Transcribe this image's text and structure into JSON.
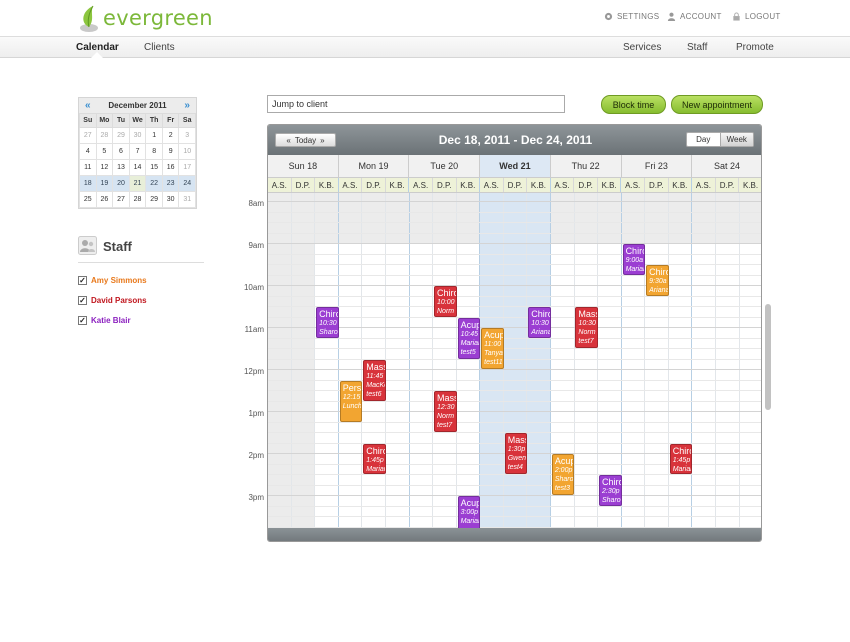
{
  "app": {
    "logo_text": "evergreen",
    "top_links": [
      "SETTINGS",
      "ACCOUNT",
      "LOGOUT"
    ],
    "nav_left": [
      "Calendar",
      "Clients"
    ],
    "nav_right": [
      "Services",
      "Staff",
      "Promote"
    ]
  },
  "minical": {
    "month": "December 2011",
    "prev": "«",
    "next": "»",
    "weekdays": [
      "Su",
      "Mo",
      "Tu",
      "We",
      "Th",
      "Fr",
      "Sa"
    ],
    "weeks": [
      [
        "27",
        "28",
        "29",
        "30",
        "1",
        "2",
        "3"
      ],
      [
        "4",
        "5",
        "6",
        "7",
        "8",
        "9",
        "10"
      ],
      [
        "11",
        "12",
        "13",
        "14",
        "15",
        "16",
        "17"
      ],
      [
        "18",
        "19",
        "20",
        "21",
        "22",
        "23",
        "24"
      ],
      [
        "25",
        "26",
        "27",
        "28",
        "29",
        "30",
        "31"
      ]
    ]
  },
  "staff": {
    "title": "Staff",
    "members": [
      {
        "name": "Amy Simmons",
        "color": "#e8781a"
      },
      {
        "name": "David Parsons",
        "color": "#c0151d"
      },
      {
        "name": "Katie Blair",
        "color": "#8b1fbf"
      }
    ]
  },
  "toolbar": {
    "jump_placeholder": "Jump to client",
    "block_time": "Block time",
    "new_appointment": "New appointment"
  },
  "calendar": {
    "today_label": "Today",
    "range": "Dec 18, 2011 - Dec 24, 2011",
    "view_day": "Day",
    "view_week": "Week",
    "days": [
      "Sun 18",
      "Mon 19",
      "Tue 20",
      "Wed 21",
      "Thu 22",
      "Fri 23",
      "Sat 24"
    ],
    "staff_initials": [
      "A.S.",
      "D.P.",
      "K.B."
    ],
    "times": [
      "8am",
      "9am",
      "10am",
      "11am",
      "12pm",
      "1pm",
      "2pm",
      "3pm"
    ],
    "colors": {
      "purple": "#9b3ed2",
      "red": "#d8333b",
      "orange": "#f2a531"
    },
    "events": [
      {
        "title": "Chiro",
        "time": "9:00a",
        "client": "Marian",
        "color": "purple"
      },
      {
        "title": "Chiro",
        "time": "9:30a",
        "client": "Ariana",
        "color": "orange"
      },
      {
        "title": "Chiro",
        "time": "10:00",
        "client": "Norm",
        "color": "red"
      },
      {
        "title": "Chiro",
        "time": "10:30",
        "client": "Sharo",
        "color": "purple"
      },
      {
        "title": "Acup",
        "time": "10:45",
        "client": "Marian",
        "extra": "test5",
        "color": "purple"
      },
      {
        "title": "Acup",
        "time": "11:00",
        "client": "Tanya",
        "extra": "test11",
        "color": "orange"
      },
      {
        "title": "Chiro",
        "time": "10:30",
        "client": "Ariana",
        "color": "purple"
      },
      {
        "title": "Mass",
        "time": "10:30",
        "client": "Norm",
        "extra": "test7",
        "color": "red"
      },
      {
        "title": "Mass",
        "time": "11:45",
        "client": "MacKe",
        "extra": "test6",
        "color": "red"
      },
      {
        "title": "Pers time",
        "time": "12:15",
        "client": "Lunch",
        "color": "orange"
      },
      {
        "title": "Mass",
        "time": "12:30",
        "client": "Norm",
        "extra": "test7",
        "color": "red"
      },
      {
        "title": "Chiro",
        "time": "1:45p",
        "client": "Marian",
        "color": "red"
      },
      {
        "title": "Mass",
        "time": "1:30p",
        "client": "Gwen",
        "extra": "test4",
        "color": "red"
      },
      {
        "title": "Acup",
        "time": "2:00p",
        "client": "Sharo",
        "extra": "test3",
        "color": "orange"
      },
      {
        "title": "Chiro",
        "time": "1:45p",
        "client": "Marian",
        "color": "red"
      },
      {
        "title": "Chiro",
        "time": "2:30p",
        "client": "Sharo",
        "color": "purple"
      },
      {
        "title": "Acup",
        "time": "3:00p",
        "client": "Marian",
        "color": "purple"
      }
    ]
  }
}
